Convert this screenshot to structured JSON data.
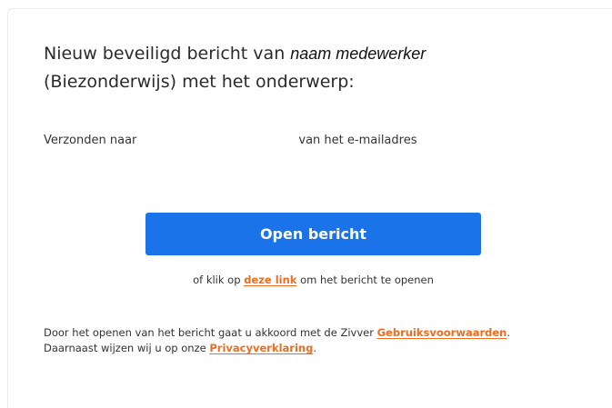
{
  "message": {
    "heading_prefix": "Nieuw beveiligd bericht van",
    "sender_name": "naam medewerker",
    "heading_suffix": "(Biezonderwijs) met het onderwerp:",
    "sent_to_label": "Verzonden naar",
    "sent_to_address_label": "van het e-mailadres"
  },
  "actions": {
    "open_button_label": "Open bericht",
    "alt_prefix": "of klik op",
    "alt_link_label": "deze link",
    "alt_suffix": "om het bericht te openen"
  },
  "legal": {
    "line1_prefix": "Door het openen van het bericht gaat u akkoord met de Zivver",
    "terms_link_label": "Gebruiksvoorwaarden",
    "line1_suffix": ".",
    "line2_prefix": "Daarnaast wijzen wij u op onze",
    "privacy_link_label": "Privacyverklaring",
    "line2_suffix": "."
  },
  "colors": {
    "button": "#1a73e8",
    "link": "#f06c1f",
    "text": "#333333"
  }
}
